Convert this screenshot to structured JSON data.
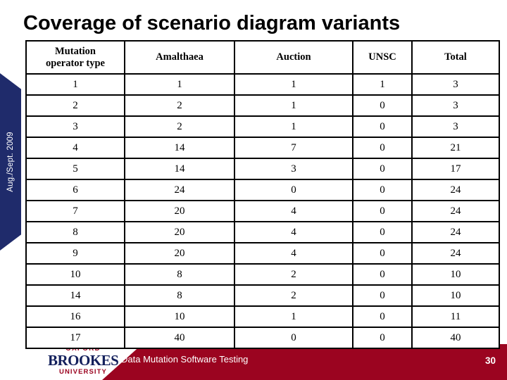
{
  "slide": {
    "title": "Coverage of scenario diagram variants",
    "page_number": "30"
  },
  "side_tab": {
    "label": "Aug./Sept. 2009",
    "background_color": "#1f2b6b",
    "text_color": "#ffffff"
  },
  "footer": {
    "banner_text": "Data Mutation Software Testing",
    "banner_color": "#9b0420",
    "logo": {
      "line1": "OXFORD",
      "line2": "BROOKES",
      "line3": "UNIVERSITY",
      "line1_color": "#9b0420",
      "line2_color": "#13205c",
      "line3_color": "#9b0420"
    }
  },
  "table": {
    "headers": [
      "Mutation operator type",
      "Amalthaea",
      "Auction",
      "UNSC",
      "Total"
    ],
    "header_first_line": "Mutation",
    "header_second_line": "operator type",
    "rows": [
      [
        "1",
        "1",
        "1",
        "1",
        "3"
      ],
      [
        "2",
        "2",
        "1",
        "0",
        "3"
      ],
      [
        "3",
        "2",
        "1",
        "0",
        "3"
      ],
      [
        "4",
        "14",
        "7",
        "0",
        "21"
      ],
      [
        "5",
        "14",
        "3",
        "0",
        "17"
      ],
      [
        "6",
        "24",
        "0",
        "0",
        "24"
      ],
      [
        "7",
        "20",
        "4",
        "0",
        "24"
      ],
      [
        "8",
        "20",
        "4",
        "0",
        "24"
      ],
      [
        "9",
        "20",
        "4",
        "0",
        "24"
      ],
      [
        "10",
        "8",
        "2",
        "0",
        "10"
      ],
      [
        "14",
        "8",
        "2",
        "0",
        "10"
      ],
      [
        "16",
        "10",
        "1",
        "0",
        "11"
      ],
      [
        "17",
        "40",
        "0",
        "0",
        "40"
      ]
    ]
  }
}
